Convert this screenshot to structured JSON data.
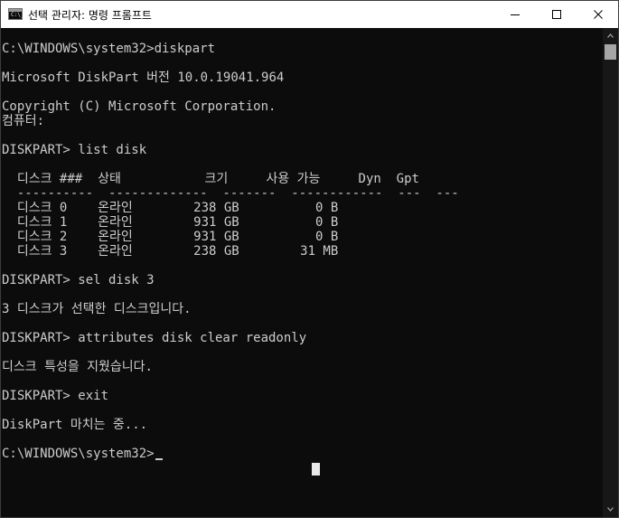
{
  "window": {
    "title": "선택 관리자: 명령 프롬프트",
    "icon_glyph": "C:\\_",
    "icons": {
      "app": "cmd-icon",
      "minimize": "minimize-icon",
      "maximize": "maximize-icon",
      "close": "close-icon"
    }
  },
  "console": {
    "lines": [
      "C:\\WINDOWS\\system32>diskpart",
      "",
      "Microsoft DiskPart 버전 10.0.19041.964",
      "",
      "Copyright (C) Microsoft Corporation.",
      "컴퓨터:",
      "",
      "DISKPART> list disk",
      "",
      "  디스크 ###  상태           크기     사용 가능     Dyn  Gpt",
      "  ----------  -------------  -------  ------------  ---  ---",
      "  디스크 0    온라인        238 GB          0 B",
      "  디스크 1    온라인        931 GB          0 B",
      "  디스크 2    온라인        931 GB          0 B",
      "  디스크 3    온라인        238 GB        31 MB",
      "",
      "DISKPART> sel disk 3",
      "",
      "3 디스크가 선택한 디스크입니다.",
      "",
      "DISKPART> attributes disk clear readonly",
      "",
      "디스크 특성을 지웠습니다.",
      "",
      "DISKPART> exit",
      "",
      "DiskPart 마치는 중...",
      "",
      "C:\\WINDOWS\\system32>"
    ]
  },
  "colors": {
    "console_bg": "#0c0c0c",
    "console_text": "#cccccc",
    "titlebar_bg": "#ffffff"
  }
}
